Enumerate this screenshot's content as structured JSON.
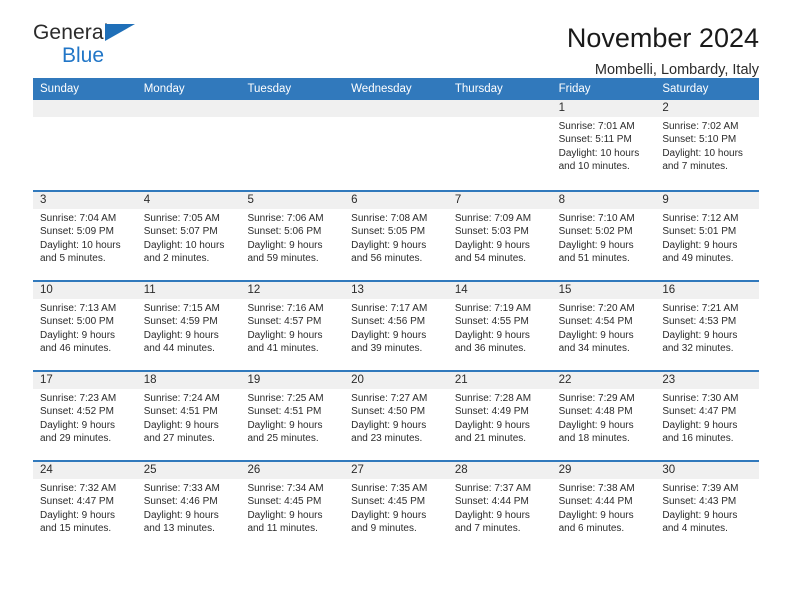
{
  "brand": {
    "name_part1": "General",
    "name_part2": "Blue",
    "flag_icon": "triangle-flag-icon"
  },
  "header": {
    "title": "November 2024",
    "subtitle": "Mombelli, Lombardy, Italy"
  },
  "colors": {
    "header_blue": "#3179bc",
    "brand_blue": "#2176c7",
    "day_band": "#f0f0f0",
    "text": "#2b2b2b"
  },
  "weekdays": [
    "Sunday",
    "Monday",
    "Tuesday",
    "Wednesday",
    "Thursday",
    "Friday",
    "Saturday"
  ],
  "weeks": [
    [
      {
        "day": "",
        "lines": []
      },
      {
        "day": "",
        "lines": []
      },
      {
        "day": "",
        "lines": []
      },
      {
        "day": "",
        "lines": []
      },
      {
        "day": "",
        "lines": []
      },
      {
        "day": "1",
        "lines": [
          "Sunrise: 7:01 AM",
          "Sunset: 5:11 PM",
          "Daylight: 10 hours and 10 minutes."
        ]
      },
      {
        "day": "2",
        "lines": [
          "Sunrise: 7:02 AM",
          "Sunset: 5:10 PM",
          "Daylight: 10 hours and 7 minutes."
        ]
      }
    ],
    [
      {
        "day": "3",
        "lines": [
          "Sunrise: 7:04 AM",
          "Sunset: 5:09 PM",
          "Daylight: 10 hours and 5 minutes."
        ]
      },
      {
        "day": "4",
        "lines": [
          "Sunrise: 7:05 AM",
          "Sunset: 5:07 PM",
          "Daylight: 10 hours and 2 minutes."
        ]
      },
      {
        "day": "5",
        "lines": [
          "Sunrise: 7:06 AM",
          "Sunset: 5:06 PM",
          "Daylight: 9 hours and 59 minutes."
        ]
      },
      {
        "day": "6",
        "lines": [
          "Sunrise: 7:08 AM",
          "Sunset: 5:05 PM",
          "Daylight: 9 hours and 56 minutes."
        ]
      },
      {
        "day": "7",
        "lines": [
          "Sunrise: 7:09 AM",
          "Sunset: 5:03 PM",
          "Daylight: 9 hours and 54 minutes."
        ]
      },
      {
        "day": "8",
        "lines": [
          "Sunrise: 7:10 AM",
          "Sunset: 5:02 PM",
          "Daylight: 9 hours and 51 minutes."
        ]
      },
      {
        "day": "9",
        "lines": [
          "Sunrise: 7:12 AM",
          "Sunset: 5:01 PM",
          "Daylight: 9 hours and 49 minutes."
        ]
      }
    ],
    [
      {
        "day": "10",
        "lines": [
          "Sunrise: 7:13 AM",
          "Sunset: 5:00 PM",
          "Daylight: 9 hours and 46 minutes."
        ]
      },
      {
        "day": "11",
        "lines": [
          "Sunrise: 7:15 AM",
          "Sunset: 4:59 PM",
          "Daylight: 9 hours and 44 minutes."
        ]
      },
      {
        "day": "12",
        "lines": [
          "Sunrise: 7:16 AM",
          "Sunset: 4:57 PM",
          "Daylight: 9 hours and 41 minutes."
        ]
      },
      {
        "day": "13",
        "lines": [
          "Sunrise: 7:17 AM",
          "Sunset: 4:56 PM",
          "Daylight: 9 hours and 39 minutes."
        ]
      },
      {
        "day": "14",
        "lines": [
          "Sunrise: 7:19 AM",
          "Sunset: 4:55 PM",
          "Daylight: 9 hours and 36 minutes."
        ]
      },
      {
        "day": "15",
        "lines": [
          "Sunrise: 7:20 AM",
          "Sunset: 4:54 PM",
          "Daylight: 9 hours and 34 minutes."
        ]
      },
      {
        "day": "16",
        "lines": [
          "Sunrise: 7:21 AM",
          "Sunset: 4:53 PM",
          "Daylight: 9 hours and 32 minutes."
        ]
      }
    ],
    [
      {
        "day": "17",
        "lines": [
          "Sunrise: 7:23 AM",
          "Sunset: 4:52 PM",
          "Daylight: 9 hours and 29 minutes."
        ]
      },
      {
        "day": "18",
        "lines": [
          "Sunrise: 7:24 AM",
          "Sunset: 4:51 PM",
          "Daylight: 9 hours and 27 minutes."
        ]
      },
      {
        "day": "19",
        "lines": [
          "Sunrise: 7:25 AM",
          "Sunset: 4:51 PM",
          "Daylight: 9 hours and 25 minutes."
        ]
      },
      {
        "day": "20",
        "lines": [
          "Sunrise: 7:27 AM",
          "Sunset: 4:50 PM",
          "Daylight: 9 hours and 23 minutes."
        ]
      },
      {
        "day": "21",
        "lines": [
          "Sunrise: 7:28 AM",
          "Sunset: 4:49 PM",
          "Daylight: 9 hours and 21 minutes."
        ]
      },
      {
        "day": "22",
        "lines": [
          "Sunrise: 7:29 AM",
          "Sunset: 4:48 PM",
          "Daylight: 9 hours and 18 minutes."
        ]
      },
      {
        "day": "23",
        "lines": [
          "Sunrise: 7:30 AM",
          "Sunset: 4:47 PM",
          "Daylight: 9 hours and 16 minutes."
        ]
      }
    ],
    [
      {
        "day": "24",
        "lines": [
          "Sunrise: 7:32 AM",
          "Sunset: 4:47 PM",
          "Daylight: 9 hours and 15 minutes."
        ]
      },
      {
        "day": "25",
        "lines": [
          "Sunrise: 7:33 AM",
          "Sunset: 4:46 PM",
          "Daylight: 9 hours and 13 minutes."
        ]
      },
      {
        "day": "26",
        "lines": [
          "Sunrise: 7:34 AM",
          "Sunset: 4:45 PM",
          "Daylight: 9 hours and 11 minutes."
        ]
      },
      {
        "day": "27",
        "lines": [
          "Sunrise: 7:35 AM",
          "Sunset: 4:45 PM",
          "Daylight: 9 hours and 9 minutes."
        ]
      },
      {
        "day": "28",
        "lines": [
          "Sunrise: 7:37 AM",
          "Sunset: 4:44 PM",
          "Daylight: 9 hours and 7 minutes."
        ]
      },
      {
        "day": "29",
        "lines": [
          "Sunrise: 7:38 AM",
          "Sunset: 4:44 PM",
          "Daylight: 9 hours and 6 minutes."
        ]
      },
      {
        "day": "30",
        "lines": [
          "Sunrise: 7:39 AM",
          "Sunset: 4:43 PM",
          "Daylight: 9 hours and 4 minutes."
        ]
      }
    ]
  ]
}
